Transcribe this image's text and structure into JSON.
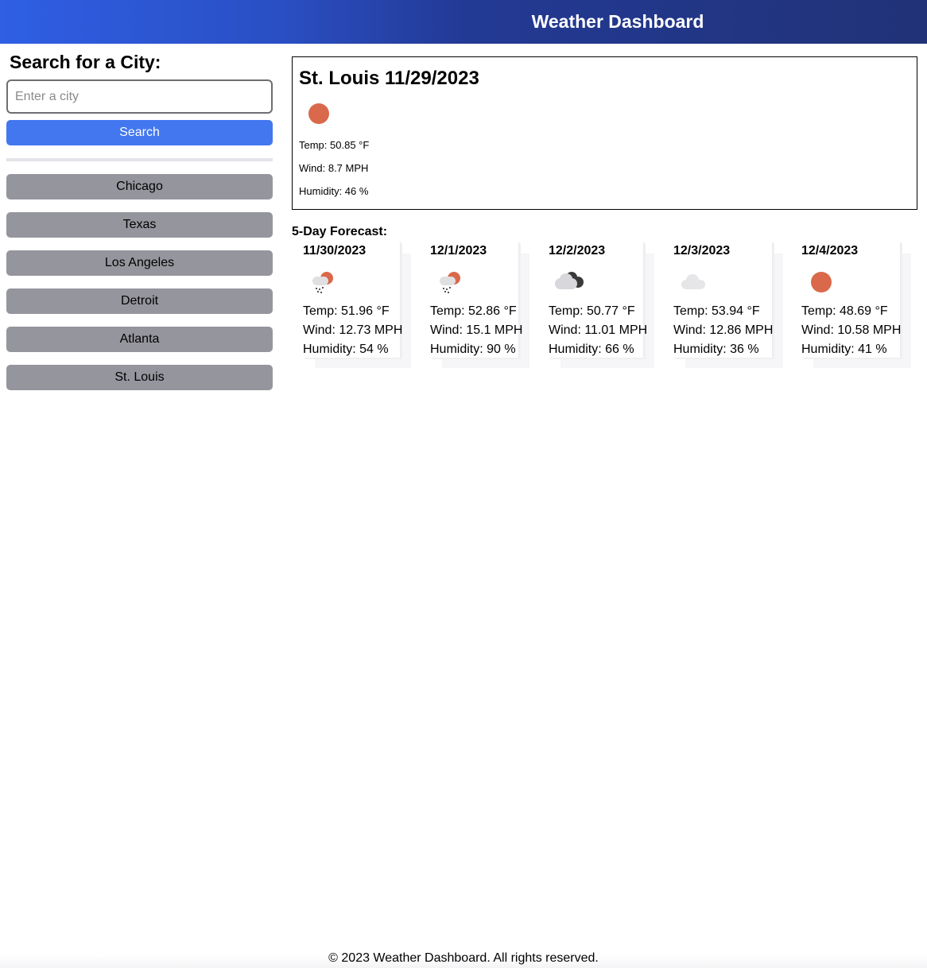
{
  "header": {
    "title": "Weather Dashboard"
  },
  "search": {
    "heading": "Search for a City:",
    "placeholder": "Enter a city",
    "button_label": "Search"
  },
  "history": [
    "Chicago",
    "Texas",
    "Los Angeles",
    "Detroit",
    "Atlanta",
    "St. Louis"
  ],
  "current": {
    "title": "St. Louis 11/29/2023",
    "icon": "sun-icon",
    "temp": "Temp: 50.85 °F",
    "wind": "Wind: 8.7 MPH",
    "humidity": "Humidity: 46 %"
  },
  "forecast": {
    "title": "5-Day Forecast:",
    "days": [
      {
        "date": "11/30/2023",
        "icon": "rain-sun-icon",
        "temp": "Temp: 51.96 °F",
        "wind": "Wind: 12.73 MPH",
        "humidity": "Humidity: 54 %"
      },
      {
        "date": "12/1/2023",
        "icon": "rain-sun-icon",
        "temp": "Temp: 52.86 °F",
        "wind": "Wind: 15.1 MPH",
        "humidity": "Humidity: 90 %"
      },
      {
        "date": "12/2/2023",
        "icon": "broken-clouds-icon",
        "temp": "Temp: 50.77 °F",
        "wind": "Wind: 11.01 MPH",
        "humidity": "Humidity: 66 %"
      },
      {
        "date": "12/3/2023",
        "icon": "cloud-icon",
        "temp": "Temp: 53.94 °F",
        "wind": "Wind: 12.86 MPH",
        "humidity": "Humidity: 36 %"
      },
      {
        "date": "12/4/2023",
        "icon": "sun-icon",
        "temp": "Temp: 48.69 °F",
        "wind": "Wind: 10.58 MPH",
        "humidity": "Humidity: 41 %"
      }
    ]
  },
  "footer": {
    "text": "© 2023 Weather Dashboard. All rights reserved."
  },
  "colors": {
    "header_start": "#2f5fe4",
    "header_end": "#213277",
    "search_button": "#4377ef",
    "history_button": "#95959d",
    "sun": "#d9694a"
  }
}
